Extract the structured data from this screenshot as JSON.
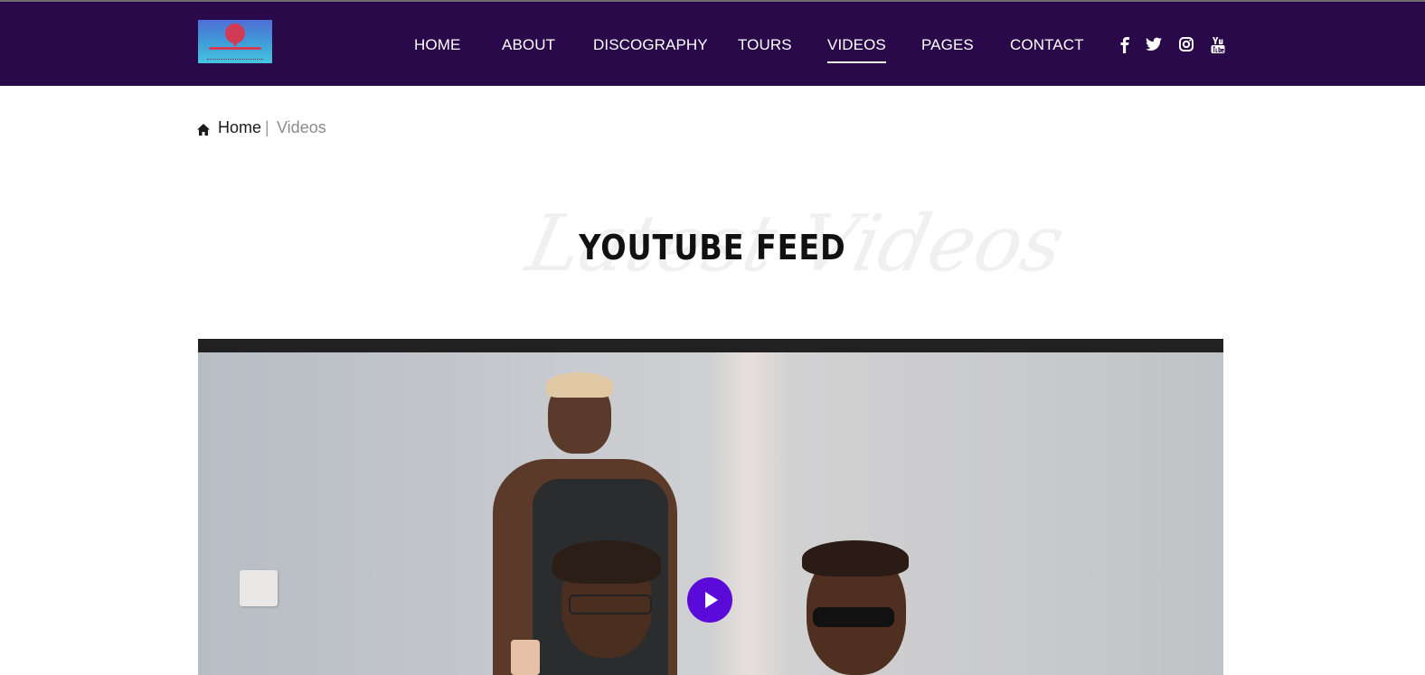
{
  "header": {
    "logo_label": "Logo",
    "nav": [
      {
        "label": "HOME",
        "active": false
      },
      {
        "label": "ABOUT",
        "active": false
      },
      {
        "label": "DISCOGRAPHY",
        "active": false
      },
      {
        "label": "TOURS",
        "active": false
      },
      {
        "label": "VIDEOS",
        "active": true
      },
      {
        "label": "PAGES",
        "active": false
      },
      {
        "label": "CONTACT",
        "active": false
      }
    ],
    "social": [
      {
        "icon": "facebook-icon"
      },
      {
        "icon": "twitter-icon"
      },
      {
        "icon": "instagram-icon"
      },
      {
        "icon": "youtube-icon"
      }
    ]
  },
  "breadcrumb": {
    "home": "Home",
    "separator": "|",
    "current": "Videos"
  },
  "section": {
    "script_text": "Latest Videos",
    "title": "YOUTUBE FEED"
  },
  "video": {
    "play_icon": "play-icon"
  },
  "colors": {
    "header_bg": "#29094a",
    "accent": "#5b0bd9"
  }
}
